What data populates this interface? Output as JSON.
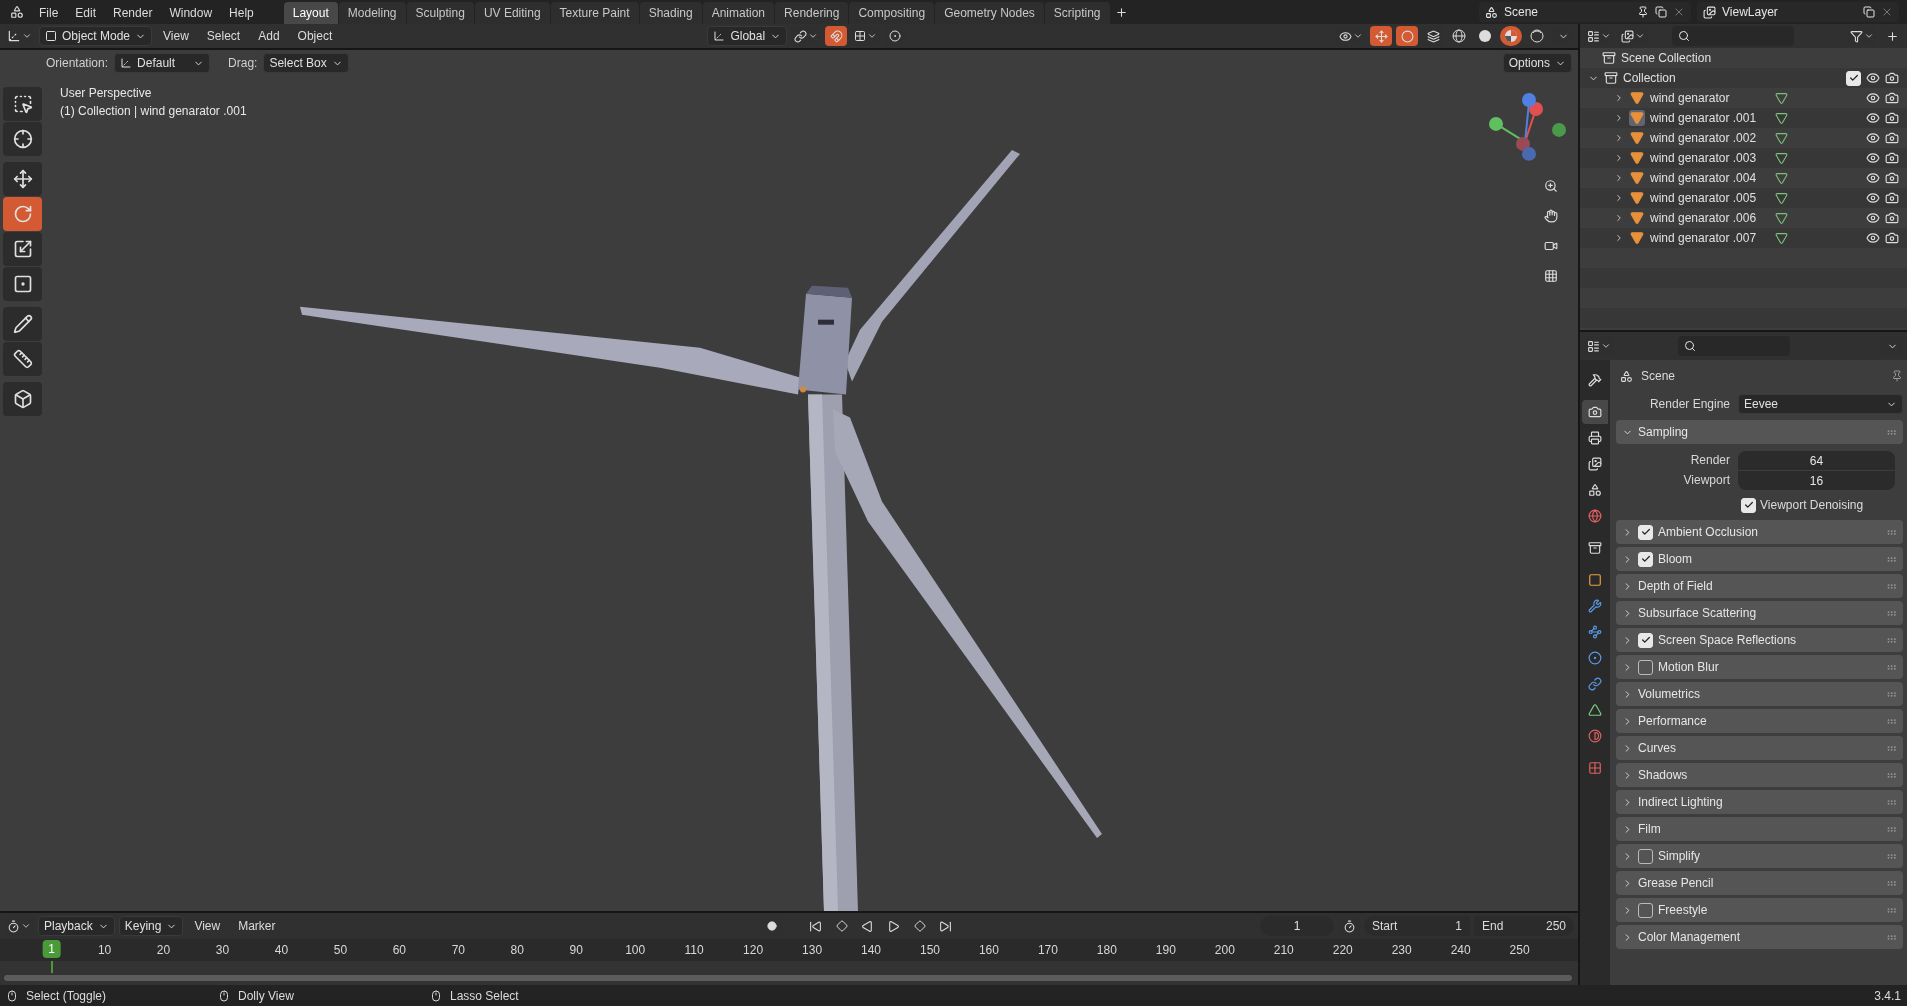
{
  "app_menu": [
    "File",
    "Edit",
    "Render",
    "Window",
    "Help"
  ],
  "workspaces": [
    {
      "label": "Layout",
      "selected": true
    },
    {
      "label": "Modeling",
      "selected": false
    },
    {
      "label": "Sculpting",
      "selected": false
    },
    {
      "label": "UV Editing",
      "selected": false
    },
    {
      "label": "Texture Paint",
      "selected": false
    },
    {
      "label": "Shading",
      "selected": false
    },
    {
      "label": "Animation",
      "selected": false
    },
    {
      "label": "Rendering",
      "selected": false
    },
    {
      "label": "Compositing",
      "selected": false
    },
    {
      "label": "Geometry Nodes",
      "selected": false
    },
    {
      "label": "Scripting",
      "selected": false
    }
  ],
  "scene": {
    "name": "Scene"
  },
  "view_layer": {
    "name": "ViewLayer"
  },
  "viewport": {
    "mode": "Object Mode",
    "menus": [
      "View",
      "Select",
      "Add",
      "Object"
    ],
    "orientation": "Global",
    "snapping": true,
    "proportional_editing": false,
    "xray": false,
    "shading": [
      {
        "kind": "wireframe",
        "selected": false
      },
      {
        "kind": "solid",
        "selected": false
      },
      {
        "kind": "material",
        "selected": true
      },
      {
        "kind": "rendered",
        "selected": false
      }
    ],
    "tool_settings": {
      "orientation_label": "Orientation:",
      "orientation": "Default",
      "drag_label": "Drag:",
      "drag": "Select Box",
      "options": "Options"
    },
    "info": [
      "User Perspective",
      "(1) Collection | wind genarator .001"
    ],
    "tools": [
      {
        "kind": "select_box",
        "selected": false
      },
      {
        "kind": "cursor",
        "selected": false
      },
      {
        "kind": "move",
        "selected": false
      },
      {
        "kind": "rotate",
        "selected": true
      },
      {
        "kind": "scale",
        "selected": false
      },
      {
        "kind": "transform",
        "selected": false
      },
      {
        "kind": "annotate",
        "selected": false
      },
      {
        "kind": "measure",
        "selected": false
      },
      {
        "kind": "add_cube",
        "selected": false
      }
    ]
  },
  "outliner": {
    "root": "Scene Collection",
    "collection": {
      "name": "Collection",
      "expanded": true,
      "checked": true,
      "children": [
        {
          "name": "wind genarator",
          "selected": false
        },
        {
          "name": "wind genarator .001",
          "selected": true
        },
        {
          "name": "wind genarator .002",
          "selected": false
        },
        {
          "name": "wind genarator .003",
          "selected": false
        },
        {
          "name": "wind genarator .004",
          "selected": false
        },
        {
          "name": "wind genarator .005",
          "selected": false
        },
        {
          "name": "wind genarator .006",
          "selected": false
        },
        {
          "name": "wind genarator .007",
          "selected": false
        }
      ]
    }
  },
  "properties": {
    "tabs": [
      {
        "kind": "tool",
        "selected": false
      },
      {
        "kind": "render",
        "selected": true
      },
      {
        "kind": "output",
        "selected": false
      },
      {
        "kind": "view_layer",
        "selected": false
      },
      {
        "kind": "scene",
        "selected": false
      },
      {
        "kind": "world",
        "selected": false
      },
      {
        "kind": "collection",
        "selected": false
      },
      {
        "kind": "object",
        "selected": false
      },
      {
        "kind": "modifiers",
        "selected": false
      },
      {
        "kind": "particles",
        "selected": false
      },
      {
        "kind": "physics",
        "selected": false
      },
      {
        "kind": "constraints",
        "selected": false
      },
      {
        "kind": "data",
        "selected": false
      },
      {
        "kind": "material",
        "selected": false
      },
      {
        "kind": "texture",
        "selected": false
      }
    ],
    "context": "Scene",
    "render_engine_label": "Render Engine",
    "render_engine": "Eevee",
    "sampling": {
      "title": "Sampling",
      "expanded": true,
      "fields": [
        {
          "label": "Render",
          "value": "64"
        },
        {
          "label": "Viewport",
          "value": "16"
        }
      ],
      "denoising": {
        "label": "Viewport Denoising",
        "checked": true
      }
    },
    "panels": [
      {
        "title": "Ambient Occlusion",
        "kind": "toggle",
        "checked": true
      },
      {
        "title": "Bloom",
        "kind": "toggle",
        "checked": true
      },
      {
        "title": "Depth of Field",
        "kind": "plain"
      },
      {
        "title": "Subsurface Scattering",
        "kind": "plain"
      },
      {
        "title": "Screen Space Reflections",
        "kind": "toggle",
        "checked": true
      },
      {
        "title": "Motion Blur",
        "kind": "toggle",
        "checked": false
      },
      {
        "title": "Volumetrics",
        "kind": "plain"
      },
      {
        "title": "Performance",
        "kind": "plain"
      },
      {
        "title": "Curves",
        "kind": "plain"
      },
      {
        "title": "Shadows",
        "kind": "plain"
      },
      {
        "title": "Indirect Lighting",
        "kind": "plain"
      },
      {
        "title": "Film",
        "kind": "plain"
      },
      {
        "title": "Simplify",
        "kind": "toggle",
        "checked": false
      },
      {
        "title": "Grease Pencil",
        "kind": "plain"
      },
      {
        "title": "Freestyle",
        "kind": "toggle",
        "checked": false
      },
      {
        "title": "Color Management",
        "kind": "plain"
      }
    ]
  },
  "timeline": {
    "menus": [
      {
        "label": "Playback",
        "kind": "dropdown"
      },
      {
        "label": "Keying",
        "kind": "dropdown"
      },
      {
        "label": "View",
        "kind": "plain"
      },
      {
        "label": "Marker",
        "kind": "plain"
      }
    ],
    "auto_keying": false,
    "current_frame": "1",
    "start_label": "Start",
    "start": "1",
    "end_label": "End",
    "end": "250",
    "playhead": "1",
    "ruler": [
      "10",
      "20",
      "30",
      "40",
      "50",
      "60",
      "70",
      "80",
      "90",
      "100",
      "110",
      "120",
      "130",
      "140",
      "150",
      "160",
      "170",
      "180",
      "190",
      "200",
      "210",
      "220",
      "230",
      "240",
      "250"
    ]
  },
  "status_bar": {
    "hints": [
      "Select (Toggle)",
      "Dolly View",
      "Lasso Select"
    ],
    "version": "3.4.1"
  }
}
